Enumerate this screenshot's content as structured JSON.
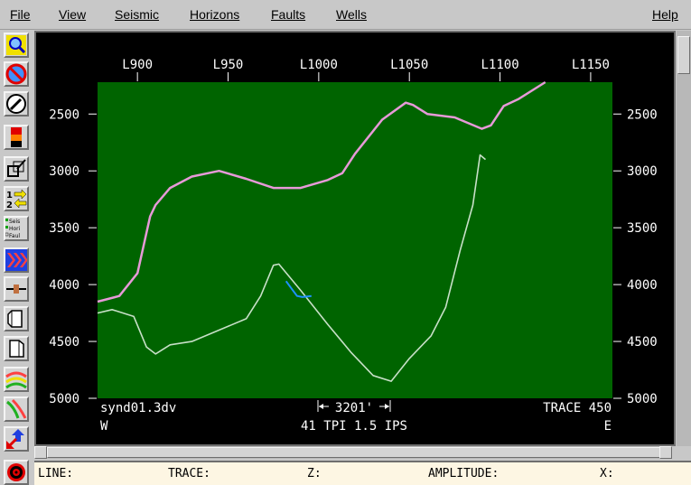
{
  "menu": {
    "file": "File",
    "view": "View",
    "seismic": "Seismic",
    "horizons": "Horizons",
    "faults": "Faults",
    "wells": "Wells",
    "help": "Help"
  },
  "toolbar": {
    "layer_labels": [
      "Seis",
      "Hori",
      "Faul"
    ],
    "step_labels": [
      "1",
      "2"
    ]
  },
  "colors": {
    "seismic_background": "#006400",
    "horizon_top": "#e79ad8",
    "horizon_bottom": "#c8e0c8",
    "fault_segment": "#1e90ff",
    "axis_text": "#ffffff"
  },
  "section": {
    "line_ticks": [
      "L900",
      "L950",
      "L1000",
      "L1050",
      "L1100",
      "L1150"
    ],
    "depth_ticks": [
      "2500",
      "3000",
      "3500",
      "4000",
      "4500",
      "5000"
    ],
    "filename": "synd01.3dv",
    "scale_label": "3201'",
    "trace_label": "TRACE 450",
    "west_label": "W",
    "east_label": "E",
    "display_params": "41 TPI 1.5 IPS"
  },
  "chart_data": {
    "type": "line",
    "xlabel": "",
    "ylabel": "",
    "xlim": [
      878,
      1162
    ],
    "ylim": [
      5000,
      2220
    ],
    "series": [
      {
        "x": [
          878,
          890,
          900,
          907,
          910,
          918,
          930,
          945,
          960,
          975,
          990,
          1005,
          1013,
          1020,
          1035,
          1048,
          1052,
          1060,
          1075,
          1090,
          1095,
          1102,
          1110,
          1125
        ],
        "y": [
          4150,
          4100,
          3900,
          3400,
          3300,
          3150,
          3050,
          3000,
          3070,
          3150,
          3150,
          3080,
          3020,
          2850,
          2550,
          2400,
          2420,
          2500,
          2530,
          2630,
          2600,
          2430,
          2370,
          2220
        ]
      },
      {
        "x": [
          878,
          886,
          898,
          905,
          910,
          918,
          930,
          945,
          960,
          968,
          975,
          978,
          990,
          1005,
          1018,
          1030,
          1040,
          1050,
          1062,
          1070,
          1078,
          1085,
          1089,
          1092
        ],
        "y": [
          4250,
          4220,
          4280,
          4550,
          4610,
          4530,
          4500,
          4400,
          4300,
          4100,
          3830,
          3820,
          4050,
          4350,
          4600,
          4800,
          4850,
          4650,
          4450,
          4200,
          3700,
          3300,
          2860,
          2900
        ]
      },
      {
        "x": [
          982,
          988,
          991,
          996
        ],
        "y": [
          3970,
          4100,
          4110,
          4100
        ]
      }
    ]
  },
  "status": {
    "line": "LINE:",
    "trace": "TRACE:",
    "z": "Z:",
    "amplitude": "AMPLITUDE:",
    "x": "X:"
  }
}
